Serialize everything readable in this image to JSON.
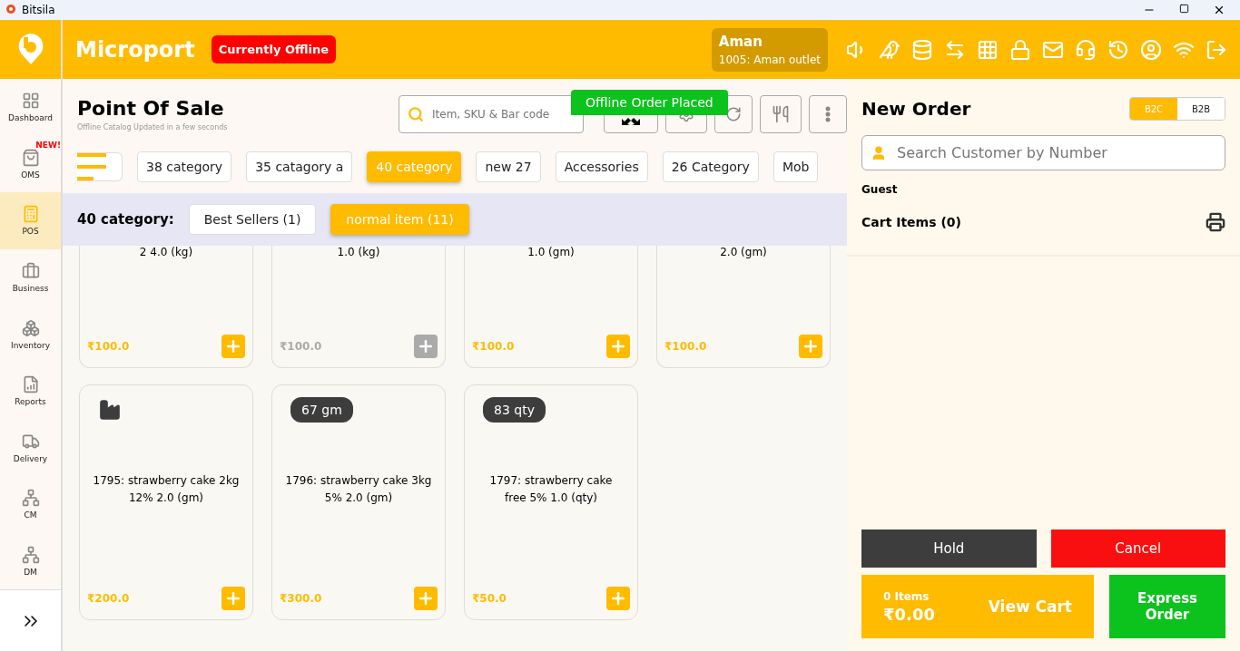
{
  "window": {
    "title": "Bitsila"
  },
  "header": {
    "brand": "Microport",
    "status": "Currently Offline",
    "user": {
      "name": "Aman",
      "outlet": "1005: Aman outlet"
    }
  },
  "sidebar": {
    "items": [
      {
        "label": "Dashboard",
        "selected": false
      },
      {
        "label": "OMS",
        "selected": false,
        "badge": "NEW!"
      },
      {
        "label": "POS",
        "selected": true
      },
      {
        "label": "Business",
        "selected": false
      },
      {
        "label": "Inventory",
        "selected": false
      },
      {
        "label": "Reports",
        "selected": false
      },
      {
        "label": "Delivery",
        "selected": false
      },
      {
        "label": "CM",
        "selected": false
      },
      {
        "label": "DM",
        "selected": false
      }
    ]
  },
  "page": {
    "title": "Point Of Sale",
    "subtitle": "Offline Catalog Updated in a few seconds",
    "search": {
      "placeholder": "Item, SKU & Bar code"
    },
    "toast": "Offline Order Placed"
  },
  "categories": [
    {
      "label": "38 category",
      "selected": false
    },
    {
      "label": "35 catagory a",
      "selected": false
    },
    {
      "label": "40 category",
      "selected": true
    },
    {
      "label": "new 27",
      "selected": false
    },
    {
      "label": "Accessories",
      "selected": false
    },
    {
      "label": "26 Category",
      "selected": false
    },
    {
      "label": "Mob",
      "selected": false
    }
  ],
  "subcategory_bar": {
    "label": "40 category:",
    "items": [
      {
        "label": "Best Sellers (1)",
        "selected": false
      },
      {
        "label": "normal item (11)",
        "selected": true
      }
    ]
  },
  "products": [
    {
      "kind": "partial",
      "name": "2 4.0 (kg)",
      "price": "₹100.0",
      "available": true
    },
    {
      "kind": "partial",
      "name": "1.0 (kg)",
      "price": "₹100.0",
      "available": false
    },
    {
      "kind": "partial",
      "name": "1.0 (gm)",
      "price": "₹100.0",
      "available": true
    },
    {
      "kind": "partial",
      "name": "2.0 (gm)",
      "price": "₹100.0",
      "available": true
    },
    {
      "kind": "full",
      "name": "1795: strawberry cake 2kg 12% 2.0 (gm)",
      "price": "₹200.0",
      "available": true,
      "factory": true
    },
    {
      "kind": "full",
      "name": "1796: strawberry cake 3kg 5% 2.0 (gm)",
      "price": "₹300.0",
      "available": true,
      "badge": "67 gm"
    },
    {
      "kind": "full",
      "name": "1797: strawberry cake free 5% 1.0 (qty)",
      "price": "₹50.0",
      "available": true,
      "badge": "83 qty"
    }
  ],
  "order": {
    "title": "New Order",
    "types": [
      {
        "label": "B2C",
        "selected": true
      },
      {
        "label": "B2B",
        "selected": false
      }
    ],
    "customer_search": {
      "placeholder": "Search Customer by Number"
    },
    "customer": "Guest",
    "cart_title": "Cart Items (0)",
    "hold": "Hold",
    "cancel": "Cancel",
    "cart_count": "0 Items",
    "cart_total": "₹0.00",
    "view_cart": "View Cart",
    "express": "Express Order"
  }
}
